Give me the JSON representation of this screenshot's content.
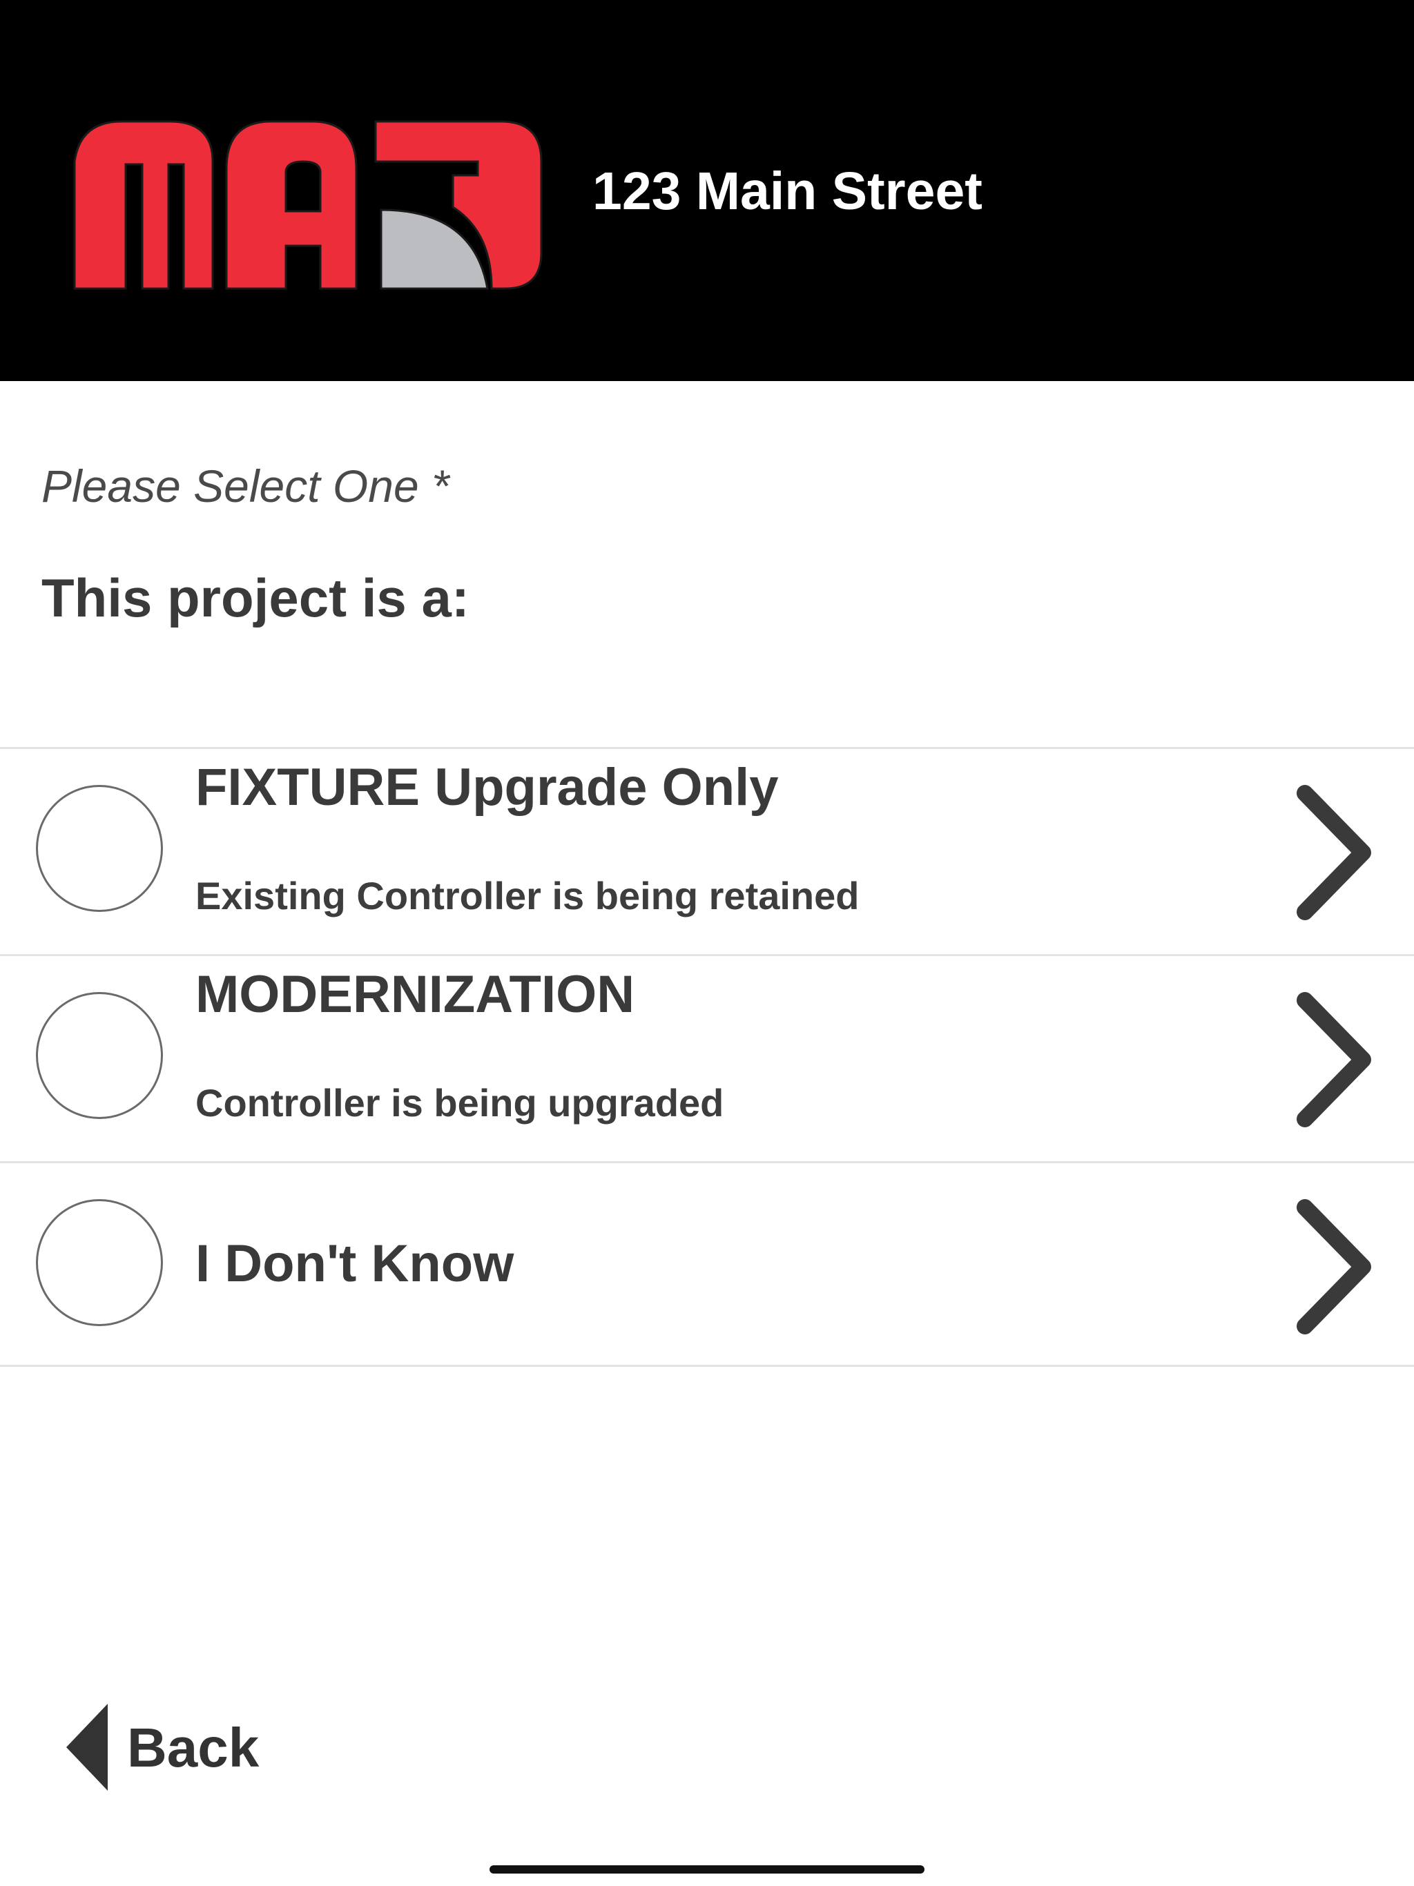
{
  "header": {
    "logo_text": "MAD",
    "address": "123 Main Street"
  },
  "prompt": {
    "instruction": "Please Select One *",
    "question": "This project is a:"
  },
  "options": [
    {
      "title": "FIXTURE Upgrade Only",
      "subtitle": "Existing Controller is being retained",
      "selected": false
    },
    {
      "title": "MODERNIZATION",
      "subtitle": "Controller is being upgraded",
      "selected": false
    },
    {
      "title": "I Don't Know",
      "subtitle": "",
      "selected": false
    }
  ],
  "footer": {
    "back_label": "Back"
  },
  "colors": {
    "header_bg": "#000000",
    "logo_red": "#ee2d3b",
    "logo_gray": "#bcbdc0",
    "text_dark": "#3a3a3a",
    "divider": "#e3e3e3"
  }
}
